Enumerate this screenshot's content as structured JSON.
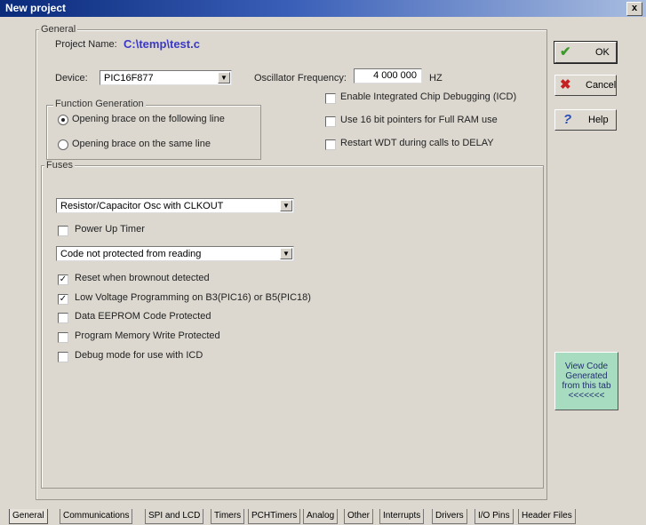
{
  "window": {
    "title": "New project",
    "close_label": "x"
  },
  "general": {
    "legend": "General",
    "project_name_label": "Project Name:",
    "project_name_value": "C:\\temp\\test.c",
    "device_label": "Device:",
    "device_value": "PIC16F877",
    "osc_label": "Oscillator Frequency:",
    "osc_value": "4 000 000",
    "osc_unit": "HZ",
    "function_generation": {
      "legend": "Function Generation",
      "options": [
        "Opening brace on the following line",
        "Opening brace on the same line"
      ],
      "selected": 0
    },
    "options": [
      {
        "label": "Enable Integrated Chip Debugging (ICD)",
        "checked": false
      },
      {
        "label": "Use 16 bit pointers for Full RAM use",
        "checked": false
      },
      {
        "label": "Restart WDT during calls to DELAY",
        "checked": false
      }
    ]
  },
  "fuses": {
    "legend": "Fuses",
    "osc_select": "Resistor/Capacitor Osc with CLKOUT",
    "power_up_timer": {
      "label": "Power Up Timer",
      "checked": false
    },
    "code_protect_select": "Code not protected from reading",
    "checks": [
      {
        "label": "Reset when brownout detected",
        "checked": true
      },
      {
        "label": "Low Voltage Programming on B3(PIC16) or B5(PIC18)",
        "checked": true
      },
      {
        "label": "Data EEPROM Code Protected",
        "checked": false
      },
      {
        "label": "Program Memory Write Protected",
        "checked": false
      },
      {
        "label": "Debug mode for use with ICD",
        "checked": false
      }
    ]
  },
  "buttons": {
    "ok": {
      "label": "OK",
      "icon": "checkmark-icon",
      "color": "#3f9a2e"
    },
    "cancel": {
      "label": "Cancel",
      "icon": "x-icon",
      "color": "#c62020"
    },
    "help": {
      "label": "Help",
      "icon": "question-icon",
      "color": "#2a4fb8"
    },
    "view_code": {
      "lines": [
        "View Code",
        "Generated",
        "from this tab",
        "<<<<<<<"
      ]
    }
  },
  "tabs": [
    "General",
    "Communications",
    "SPI and LCD",
    "Timers",
    "PCHTimers",
    "Analog",
    "Other",
    "Interrupts",
    "Drivers",
    "I/O Pins",
    "Header Files"
  ],
  "active_tab": "General"
}
